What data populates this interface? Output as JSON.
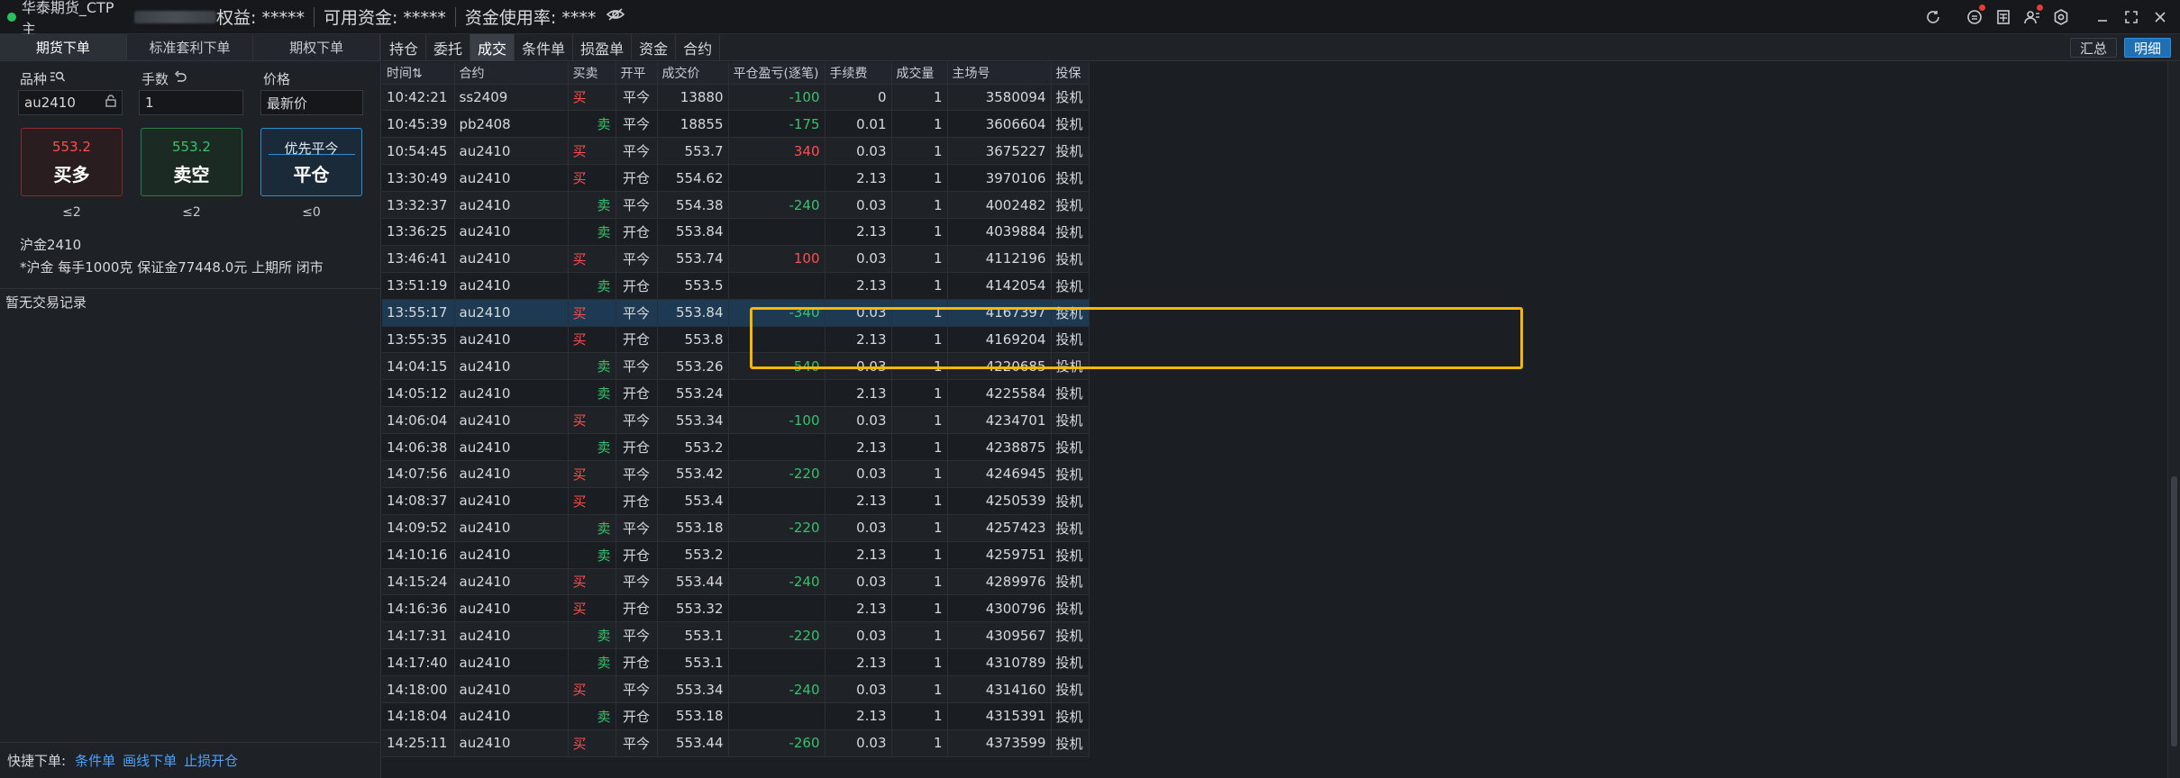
{
  "titlebar": {
    "app_name": "华泰期货_CTP主",
    "equity": "权益: *****",
    "available": "可用资金: *****",
    "usage": "资金使用率: ****"
  },
  "left": {
    "tabs": [
      "期货下单",
      "标准套利下单",
      "期权下单"
    ],
    "labels": {
      "symbol": "品种",
      "qty": "手数",
      "price": "价格"
    },
    "inputs": {
      "symbol": "au2410",
      "qty": "1",
      "price": "最新价"
    },
    "buttons": [
      {
        "price": "553.2",
        "label": "买多"
      },
      {
        "price": "553.2",
        "label": "卖空"
      },
      {
        "price": "优先平今",
        "label": "平仓"
      }
    ],
    "limits": [
      "≤2",
      "≤2",
      "≤0"
    ],
    "contract_name": "沪金2410",
    "contract_desc": "*沪金 每手1000克 保证金77448.0元 上期所 闭市",
    "no_records": "暂无交易记录",
    "quick_label": "快捷下单:",
    "quick_links": [
      "条件单",
      "画线下单",
      "止损开仓"
    ]
  },
  "right": {
    "tabs": [
      "持仓",
      "委托",
      "成交",
      "条件单",
      "损盈单",
      "资金",
      "合约"
    ],
    "active_tab": 2,
    "buttons": [
      "汇总",
      "明细"
    ],
    "columns": [
      "时间⇅",
      "合约",
      "买卖",
      "开平",
      "成交价",
      "平仓盈亏(逐笔)",
      "手续费",
      "成交量",
      "主场号",
      "投保"
    ],
    "rows": [
      [
        "10:42:21",
        "ss2409",
        "买",
        "平今",
        "13880",
        "-100",
        "0",
        "1",
        "3580094",
        "投机"
      ],
      [
        "10:45:39",
        "pb2408",
        "卖",
        "平今",
        "18855",
        "-175",
        "0.01",
        "1",
        "3606604",
        "投机"
      ],
      [
        "10:54:45",
        "au2410",
        "买",
        "平今",
        "553.7",
        "340",
        "0.03",
        "1",
        "3675227",
        "投机"
      ],
      [
        "13:30:49",
        "au2410",
        "买",
        "开仓",
        "554.62",
        "",
        "2.13",
        "1",
        "3970106",
        "投机"
      ],
      [
        "13:32:37",
        "au2410",
        "卖",
        "平今",
        "554.38",
        "-240",
        "0.03",
        "1",
        "4002482",
        "投机"
      ],
      [
        "13:36:25",
        "au2410",
        "卖",
        "开仓",
        "553.84",
        "",
        "2.13",
        "1",
        "4039884",
        "投机"
      ],
      [
        "13:46:41",
        "au2410",
        "买",
        "平今",
        "553.74",
        "100",
        "0.03",
        "1",
        "4112196",
        "投机"
      ],
      [
        "13:51:19",
        "au2410",
        "卖",
        "开仓",
        "553.5",
        "",
        "2.13",
        "1",
        "4142054",
        "投机"
      ],
      [
        "13:55:17",
        "au2410",
        "买",
        "平今",
        "553.84",
        "-340",
        "0.03",
        "1",
        "4167397",
        "投机"
      ],
      [
        "13:55:35",
        "au2410",
        "买",
        "开仓",
        "553.8",
        "",
        "2.13",
        "1",
        "4169204",
        "投机"
      ],
      [
        "14:04:15",
        "au2410",
        "卖",
        "平今",
        "553.26",
        "-540",
        "0.03",
        "1",
        "4220685",
        "投机"
      ],
      [
        "14:05:12",
        "au2410",
        "卖",
        "开仓",
        "553.24",
        "",
        "2.13",
        "1",
        "4225584",
        "投机"
      ],
      [
        "14:06:04",
        "au2410",
        "买",
        "平今",
        "553.34",
        "-100",
        "0.03",
        "1",
        "4234701",
        "投机"
      ],
      [
        "14:06:38",
        "au2410",
        "卖",
        "开仓",
        "553.2",
        "",
        "2.13",
        "1",
        "4238875",
        "投机"
      ],
      [
        "14:07:56",
        "au2410",
        "买",
        "平今",
        "553.42",
        "-220",
        "0.03",
        "1",
        "4246945",
        "投机"
      ],
      [
        "14:08:37",
        "au2410",
        "买",
        "开仓",
        "553.4",
        "",
        "2.13",
        "1",
        "4250539",
        "投机"
      ],
      [
        "14:09:52",
        "au2410",
        "卖",
        "平今",
        "553.18",
        "-220",
        "0.03",
        "1",
        "4257423",
        "投机"
      ],
      [
        "14:10:16",
        "au2410",
        "卖",
        "开仓",
        "553.2",
        "",
        "2.13",
        "1",
        "4259751",
        "投机"
      ],
      [
        "14:15:24",
        "au2410",
        "买",
        "平今",
        "553.44",
        "-240",
        "0.03",
        "1",
        "4289976",
        "投机"
      ],
      [
        "14:16:36",
        "au2410",
        "买",
        "开仓",
        "553.32",
        "",
        "2.13",
        "1",
        "4300796",
        "投机"
      ],
      [
        "14:17:31",
        "au2410",
        "卖",
        "平今",
        "553.1",
        "-220",
        "0.03",
        "1",
        "4309567",
        "投机"
      ],
      [
        "14:17:40",
        "au2410",
        "卖",
        "开仓",
        "553.1",
        "",
        "2.13",
        "1",
        "4310789",
        "投机"
      ],
      [
        "14:18:00",
        "au2410",
        "买",
        "平今",
        "553.34",
        "-240",
        "0.03",
        "1",
        "4314160",
        "投机"
      ],
      [
        "14:18:04",
        "au2410",
        "卖",
        "开仓",
        "553.18",
        "",
        "2.13",
        "1",
        "4315391",
        "投机"
      ],
      [
        "14:25:11",
        "au2410",
        "买",
        "平今",
        "553.44",
        "-260",
        "0.03",
        "1",
        "4373599",
        "投机"
      ]
    ],
    "selected_row": 8
  },
  "colors": {
    "buy": "#ff4d4f",
    "sell": "#37c26b",
    "accent": "#1f6fb5",
    "highlight": "#f5b800"
  }
}
